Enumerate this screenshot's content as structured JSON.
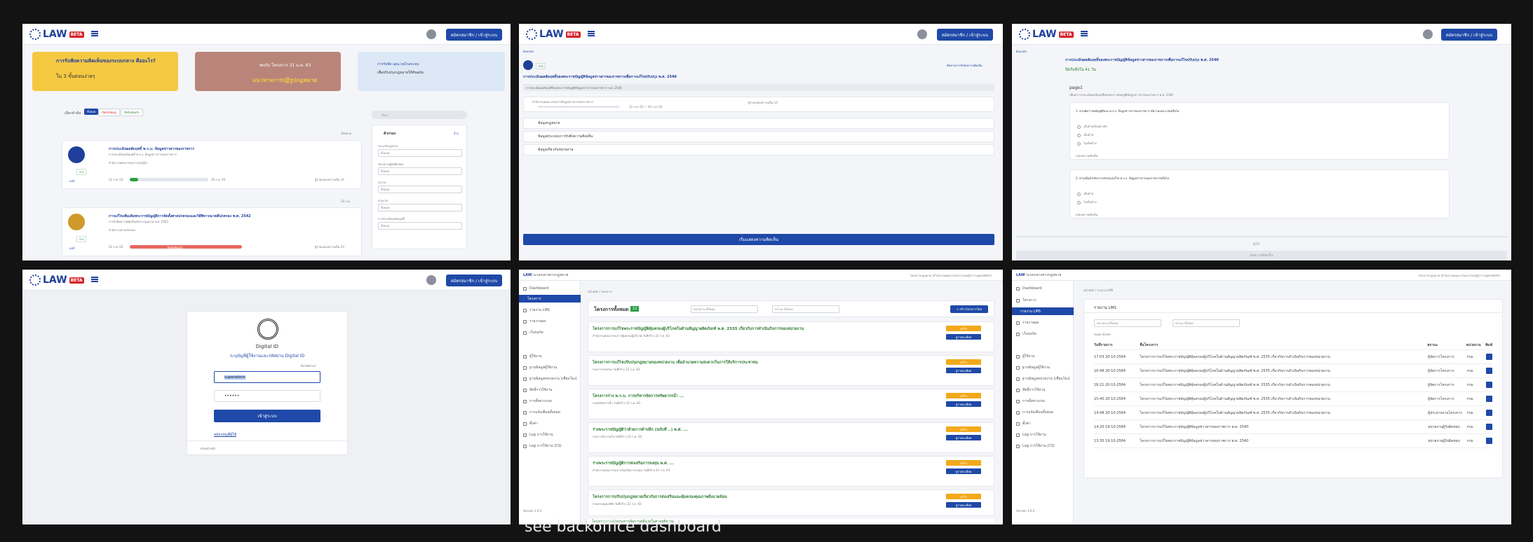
{
  "common": {
    "logo_text": "LAW",
    "beta": "BETA",
    "login_button": "สมัครสมาชิก / เข้าสู่ระบบ"
  },
  "p1": {
    "banner1_title": "การรับฟังความคิดเห็นของระบบกลาง คืออะไร?",
    "banner1_sub": "ใน 3 ขั้นตอนง่ายๆ",
    "banner2_line1": "พบกับ โครงการ 31 ม.ค. 63",
    "banner2_line2": "แนวทางการปฏิรูปกฎหมาย",
    "banner3_line1": "การรับฟัง แผน กลไกลระบบ",
    "banner3_line2": "เพื่อปรับปรุงกฎหมายให้ทันสมัย",
    "filter_label": "เลือกหัวข้อ",
    "tabs": [
      "ทั้งหมด",
      "เปิดรับฟังอยู่",
      "ปิดรับฟังแล้ว"
    ],
    "search_placeholder": "ค้นหา",
    "sort_label": "เรียงตาม",
    "filter_title": "ตัวกรอง",
    "clear_label": "ล้าง",
    "filter_fields": [
      {
        "label": "ประเภทกฎหมาย",
        "value": "ทั้งหมด"
      },
      {
        "label": "หน่วยงานผู้รับผิดชอบ",
        "value": "ทั้งหมด"
      },
      {
        "label": "สถานะ",
        "value": "ทั้งหมด"
      },
      {
        "label": "ช่วงเวลา",
        "value": "ทั้งหมด"
      },
      {
        "label": "การประเมินผลสัมฤทธิ์",
        "value": "ทั้งหมด"
      }
    ],
    "card1_title": "การประเมินผลสัมฤทธิ์ พ.ร.บ. ข้อมูลข่าวสารของราชการ",
    "card1_sub": "การประเมินผลสัมฤทธิ์ พ.ร.บ. ข้อมูลข่าวสารของราชการ",
    "card1_agency": "สำนักงานคณะกรรมการกฤษฎีกา",
    "card1_count": "ผู้ร่วมแสดงความเห็น 14",
    "card1_start": "22 ก.ค. 63",
    "card1_end": "30 ก.ค. 63",
    "card1_left": "เหลือ 41 วัน",
    "card1_tag": "ร่าง",
    "card2_title": "การแก้ไขเพิ่มเติมพระราชบัญญัติการจัดตั้งศาลปกครองและวิธีพิจารณาคดีปกครอง พ.ศ. 2542",
    "card2_sub": "การรับฟังความคิดเห็นต่อร่างกฎหมาย พ.ศ. 2563",
    "card2_agency": "สำนักงานศาลปกครอง",
    "card2_count": "ผู้ร่วมแสดงความเห็น 23",
    "card2_start": "22 ก.ค. 63",
    "card2_end": "31 ก.ค. 63",
    "card2_status": "ปิดรับฟังแล้ว",
    "card2_tag": "ร่าง",
    "share": "แชร์",
    "date_badge1": "22 ก.ค.",
    "date_badge2": "7 ส.ค."
  },
  "p2": {
    "back": "ย้อนกลับ",
    "subscribe": "ติดตามการรับฟังความคิดเห็น",
    "title": "การประเมินผลสัมฤทธิ์ของพระราชบัญญัติข้อมูลข่าวสารของราชการเพื่อการแก้ไขปรับปรุง พ.ศ. 2540",
    "desc": "การประเมินผลสัมฤทธิ์ของพระราชบัญญัติข้อมูลข่าวสารของราชการ พ.ศ. 2540",
    "status": "ร่าง",
    "agency_label": "สำนักงานคณะกรรมการข้อมูลข่าวสารของราชการ",
    "dates": "22 ก.ค. 63 — 30 ก.ค. 63",
    "count": "ผู้ร่วมแสดงความเห็น 14",
    "sections": [
      "ข้อมูลกฎหมาย",
      "ข้อมูลประกอบการรับฟังความคิดเห็น",
      "ข้อมูลเกี่ยวกับหน่วยงาน"
    ],
    "cta": "เริ่มแสดงความคิดเห็น"
  },
  "p3": {
    "back": "ย้อนกลับ",
    "title": "การประเมินผลสัมฤทธิ์ของพระราชบัญญัติข้อมูลข่าวสารของราชการเพื่อการแก้ไขปรับปรุง พ.ศ. 2540",
    "remaining": "ปิดรับฟังใน 41 วัน",
    "page_label": "page1",
    "page_desc": "เนื้อหาการประเมินผลสัมฤทธิ์ของพระราชบัญญัติข้อมูลข่าวสารของราชการ พ.ศ. 2540",
    "q1": "1. ท่านคิดว่าบทบัญญัติของ พ.ร.บ. ข้อมูลข่าวสารของราชการ มีความเหมาะสมหรือไม่",
    "q1_options": [
      "เห็นด้วยเป็นอย่างยิ่ง",
      "เห็นด้วย",
      "ไม่เห็นด้วย"
    ],
    "q2": "2. ท่านเห็นด้วยกับการปรับปรุงแก้ไข พ.ร.บ. ข้อมูลข่าวสารของราชการหรือไม่",
    "q2_options": [
      "เห็นด้วย",
      "ไม่เห็นด้วย"
    ],
    "comment": "แสดงความคิดเห็น",
    "pager": "0/15",
    "submit": "ส่งความคิดเห็น"
  },
  "p4": {
    "card_title": "Digital ID",
    "card_sub": "ระบุบัญชีผู้ใช้งานและรหัสผ่าน Digital ID",
    "forgot": "ลืมรหัสผ่าน?",
    "username_value": "superadmin",
    "password_placeholder": "••••••",
    "login": "เข้าสู่ระบบ",
    "register": "สมัครบัญชีผู้ใช้",
    "back": "กลับหน้าหลัก"
  },
  "p5": {
    "brand": "ระบบกลางทางกฎหมาย",
    "user": "โครงการกฎหมาย (สำนักงานคณะกรรมการกฤษฎีกา)  superadmin",
    "breadcrumb": "หน้าหลัก / โครงการ",
    "sidebar": [
      "Dashboard",
      "โครงการ",
      "รายงาน LMS",
      "รายงานผล",
      "เว็บบอร์ด",
      "ผู้ใช้งาน",
      "ฐานข้อมูลผู้ใช้งาน",
      "ฐานข้อมูลหน่วยงาน (เชื่อมโยง)",
      "สิทธิ์การใช้งาน",
      "การตั้งค่าระบบ",
      "การแจ้งเตือนทั้งหมด",
      "ตั้งค่า",
      "Log การใช้งาน",
      "Log การใช้งาน (CS)"
    ],
    "version": "Version 1.0.0",
    "section_title": "โครงการทั้งหมด",
    "count": "12",
    "filter1": "หน่วยงาน ทั้งหมด",
    "filter2": "สถานะ ทั้งหมด",
    "add": "+ สร้างโครงการใหม่",
    "items": [
      {
        "title": "โครงการการแก้ไขพระราชบัญญัติคุ้มครองผู้บริโภคในด้านสัญญาผลิตภัณฑ์ พ.ศ. 2535 เกี่ยวกับการดำเนินกิจการของหน่วยงาน",
        "sub": "สำนักงานคณะกรรมการคุ้มครองผู้บริโภค  วันที่สร้าง 22 ก.ค. 63"
      },
      {
        "title": "โครงการการแก้ไขปรับปรุงกฎหมายของหน่วยงาน เพื่ออำนวยความสะดวกในการให้บริการประชาชน",
        "sub": "กรมการปกครอง  วันที่สร้าง 22 ก.ค. 63"
      },
      {
        "title": "โครงการร่าง พ.ร.บ. การบริหารจัดการทรัพยากรน้ำ ...",
        "sub": "กรมทรัพยากรน้ำ  วันที่สร้าง 22 ก.ค. 63"
      },
      {
        "title": "ร่างพระราชบัญญัติว่าด้วยการค้าปลีก (ฉบับที่ ..) พ.ศ. ...",
        "sub": "กรมการค้าภายใน  วันที่สร้าง 22 ก.ค. 63"
      },
      {
        "title": "ร่างพระราชบัญญัติการส่งเสริมการลงทุน พ.ศ. ...",
        "sub": "สำนักงานคณะกรรมการส่งเสริมการลงทุน  วันที่สร้าง 22 ก.ค. 63"
      },
      {
        "title": "โครงการการปรับปรุงกฎหมายเกี่ยวกับการส่งเสริมและคุ้มครองคุณภาพสิ่งแวดล้อม",
        "sub": "กรมควบคุมมลพิษ  วันที่สร้าง 22 ก.ค. 63"
      },
      {
        "title": "โครงการการปรับปรุงการจัดการคดีแพ่งในศาลยุติธรรม",
        "sub": "สำนักงานศาลยุติธรรม  วันที่สร้าง 22 ก.ค. 63"
      }
    ],
    "btn_edit": "แก้ไข",
    "btn_view": "ดูรายละเอียด",
    "footer_text": "see backoffice dashboard"
  },
  "p6": {
    "brand": "ระบบกลางทางกฎหมาย",
    "user": "โครงการกฎหมาย (สำนักงานคณะกรรมการกฤษฎีกา)  superadmin",
    "breadcrumb": "หน้าหลัก / รายงาน LMS",
    "sidebar": [
      "Dashboard",
      "โครงการ",
      "รายงาน LMS",
      "รายงานผล",
      "เว็บบอร์ด",
      "ผู้ใช้งาน",
      "ฐานข้อมูลผู้ใช้งาน",
      "ฐานข้อมูลหน่วยงาน (เชื่อมโยง)",
      "สิทธิ์การใช้งาน",
      "การตั้งค่าระบบ",
      "การแจ้งเตือนทั้งหมด",
      "ตั้งค่า",
      "Log การใช้งาน",
      "Log การใช้งาน (CS)"
    ],
    "version": "Version 1.0.0",
    "section_title": "รายงาน LMS",
    "filter1": "หน่วยงาน ทั้งหมด",
    "filter2": "สถานะ ทั้งหมด",
    "export": "ส่งออก Excel",
    "headers": [
      "วันที่รายการ",
      "ชื่อโครงการ",
      "สถานะ",
      "หน่วยงาน",
      "พิมพ์"
    ],
    "rows": [
      [
        "17:03 20-10-2564",
        "โครงการการแก้ไขพระราชบัญญัติคุ้มครองผู้บริโภคในด้านสัญญาผลิตภัณฑ์ พ.ศ. 2535 เกี่ยวกับการดำเนินกิจการของหน่วยงาน",
        "ผู้จัดการโครงการ",
        "กรม"
      ],
      [
        "16:48 20-10-2564",
        "โครงการการแก้ไขพระราชบัญญัติคุ้มครองผู้บริโภคในด้านสัญญาผลิตภัณฑ์ พ.ศ. 2535 เกี่ยวกับการดำเนินกิจการของหน่วยงาน",
        "ผู้จัดการโครงการ",
        "กรม"
      ],
      [
        "16:21 20-10-2564",
        "โครงการการแก้ไขพระราชบัญญัติคุ้มครองผู้บริโภคในด้านสัญญาผลิตภัณฑ์ พ.ศ. 2535 เกี่ยวกับการดำเนินกิจการของหน่วยงาน",
        "ผู้จัดการโครงการ",
        "กรม"
      ],
      [
        "15:40 20-10-2564",
        "โครงการการแก้ไขพระราชบัญญัติคุ้มครองผู้บริโภคในด้านสัญญาผลิตภัณฑ์ พ.ศ. 2535 เกี่ยวกับการดำเนินกิจการของหน่วยงาน",
        "ผู้จัดการโครงการ",
        "กรม"
      ],
      [
        "14:48 20-10-2564",
        "โครงการการแก้ไขพระราชบัญญัติคุ้มครองผู้บริโภคในด้านสัญญาผลิตภัณฑ์ พ.ศ. 2535 เกี่ยวกับการดำเนินกิจการของหน่วยงาน",
        "ผู้ประสานงานโครงการ",
        "กรม"
      ],
      [
        "14:20 19-10-2564",
        "โครงการการแก้ไขพระราชบัญญัติข้อมูลข่าวสารของราชการ พ.ศ. 2540",
        "หน่วยงานผู้รับผิดชอบ",
        "กรม"
      ],
      [
        "13:35 19-10-2564",
        "โครงการการแก้ไขพระราชบัญญัติข้อมูลข่าวสารของราชการ พ.ศ. 2540",
        "หน่วยงานผู้รับผิดชอบ",
        "กรม"
      ]
    ]
  }
}
